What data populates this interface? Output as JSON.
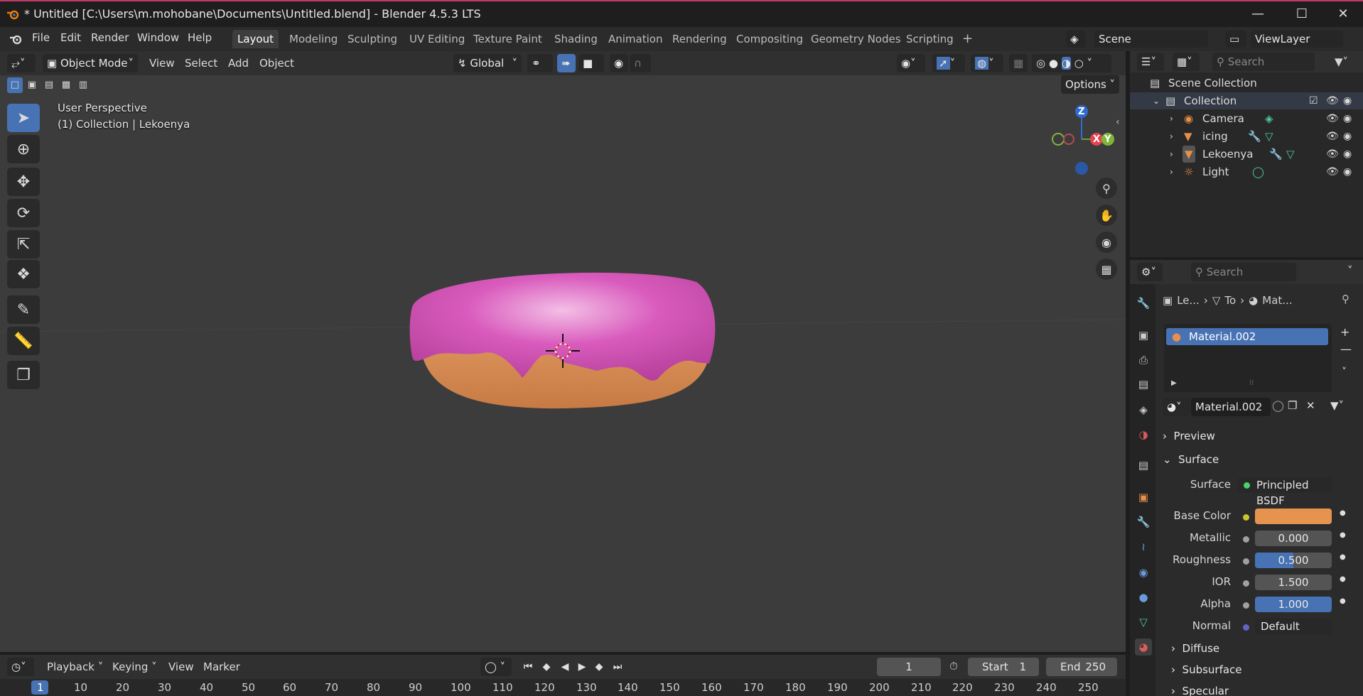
{
  "window": {
    "title": "* Untitled [C:\\Users\\m.mohobane\\Documents\\Untitled.blend] - Blender 4.5.3 LTS"
  },
  "menu": [
    "File",
    "Edit",
    "Render",
    "Window",
    "Help"
  ],
  "workspaces": [
    "Layout",
    "Modeling",
    "Sculpting",
    "UV Editing",
    "Texture Paint",
    "Shading",
    "Animation",
    "Rendering",
    "Compositing",
    "Geometry Nodes",
    "Scripting"
  ],
  "scene": {
    "name": "Scene",
    "view_layer": "ViewLayer"
  },
  "viewport": {
    "mode": "Object Mode",
    "menus": [
      "View",
      "Select",
      "Add",
      "Object"
    ],
    "orientation": "Global",
    "options_label": "Options",
    "perspective_label": "User Perspective",
    "collection_label": "(1) Collection | Lekoenya",
    "gizmo": {
      "z": "Z",
      "x": "X",
      "y": "Y"
    },
    "donut_colors": {
      "icing": "#d454b4",
      "dough": "#d98c55"
    }
  },
  "outliner": {
    "search_placeholder": "Search",
    "root": "Scene Collection",
    "collection": "Collection",
    "items": [
      "Camera",
      "icing",
      "Lekoenya",
      "Light"
    ]
  },
  "properties": {
    "search_placeholder": "Search",
    "breadcrumb": [
      "Le...",
      "To",
      "Mat..."
    ],
    "material_slot": "Material.002",
    "material_name": "Material.002",
    "panels": {
      "preview": "Preview",
      "surface": "Surface",
      "diffuse": "Diffuse",
      "subsurface": "Subsurface",
      "specular": "Specular"
    },
    "surface": {
      "label": "Surface",
      "value": "Principled BSDF"
    },
    "fields": [
      {
        "label": "Base Color",
        "value": "",
        "color": "#e69350"
      },
      {
        "label": "Metallic",
        "value": "0.000",
        "fill": 0.0
      },
      {
        "label": "Roughness",
        "value": "0.500",
        "fill": 0.5
      },
      {
        "label": "IOR",
        "value": "1.500",
        "fill": 0.0
      },
      {
        "label": "Alpha",
        "value": "1.000",
        "fill": 1.0
      },
      {
        "label": "Normal",
        "value": "Default"
      }
    ]
  },
  "timeline": {
    "menus": [
      "Playback",
      "Keying",
      "View",
      "Marker"
    ],
    "current_frame": "1",
    "start_label": "Start",
    "start": "1",
    "end_label": "End",
    "end": "250",
    "ticks": [
      "1",
      "10",
      "20",
      "30",
      "40",
      "50",
      "60",
      "70",
      "80",
      "90",
      "100",
      "110",
      "120",
      "130",
      "140",
      "150",
      "160",
      "170",
      "180",
      "190",
      "200",
      "210",
      "220",
      "230",
      "240",
      "250"
    ]
  }
}
